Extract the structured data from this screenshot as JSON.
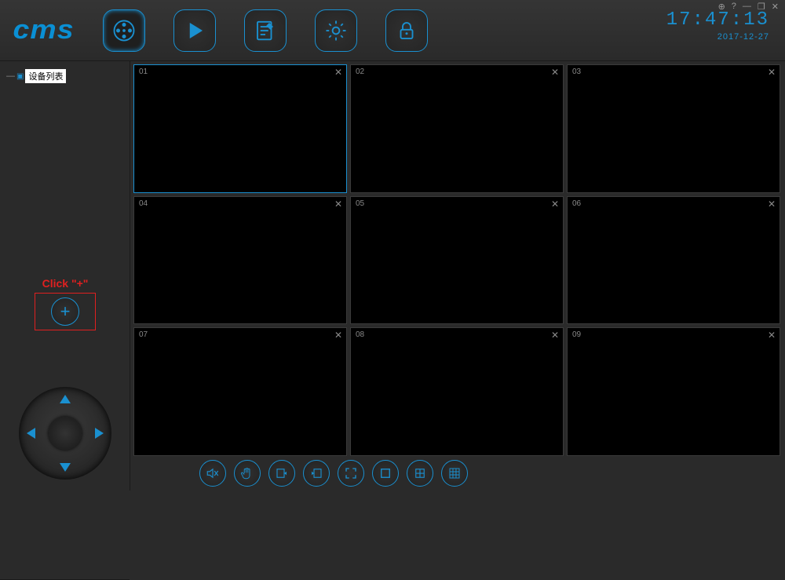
{
  "app": {
    "logo": "cms"
  },
  "clock": {
    "time": "17:47:13",
    "date": "2017-12-27"
  },
  "winctrl": {
    "pop": "⊕",
    "help": "?",
    "min": "—",
    "max": "❐",
    "close": "✕"
  },
  "sidebar": {
    "device_list_label": "设备列表",
    "add_hint": "Click \"+\"",
    "add_symbol": "+"
  },
  "channels": [
    {
      "num": "01",
      "selected": true
    },
    {
      "num": "02",
      "selected": false
    },
    {
      "num": "03",
      "selected": false
    },
    {
      "num": "04",
      "selected": false
    },
    {
      "num": "05",
      "selected": false
    },
    {
      "num": "06",
      "selected": false
    },
    {
      "num": "07",
      "selected": false
    },
    {
      "num": "08",
      "selected": false
    },
    {
      "num": "09",
      "selected": false
    }
  ],
  "icons": {
    "close_x": "✕"
  }
}
